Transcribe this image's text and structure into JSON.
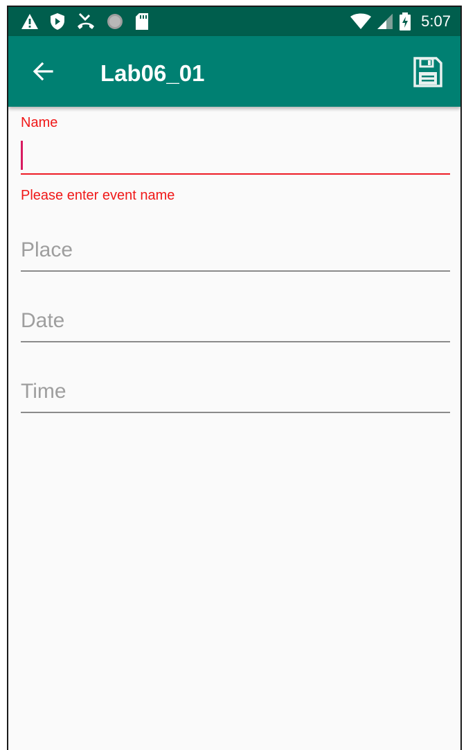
{
  "status_bar": {
    "time": "5:07",
    "icons_left": [
      "warning-icon",
      "shield-icon",
      "missed-call-icon",
      "circle-icon",
      "sd-card-icon"
    ],
    "icons_right": [
      "wifi-icon",
      "signal-icon",
      "battery-charging-icon"
    ]
  },
  "app_bar": {
    "title": "Lab06_01",
    "back_icon": "arrow-back-icon",
    "action_icon": "save-icon",
    "color": "#008072",
    "status_color": "#005e4d"
  },
  "form": {
    "name": {
      "label": "Name",
      "value": "",
      "error": "Please enter event name",
      "error_color": "#f01818"
    },
    "place": {
      "placeholder": "Place",
      "value": ""
    },
    "date": {
      "placeholder": "Date",
      "value": ""
    },
    "time": {
      "placeholder": "Time",
      "value": ""
    }
  }
}
